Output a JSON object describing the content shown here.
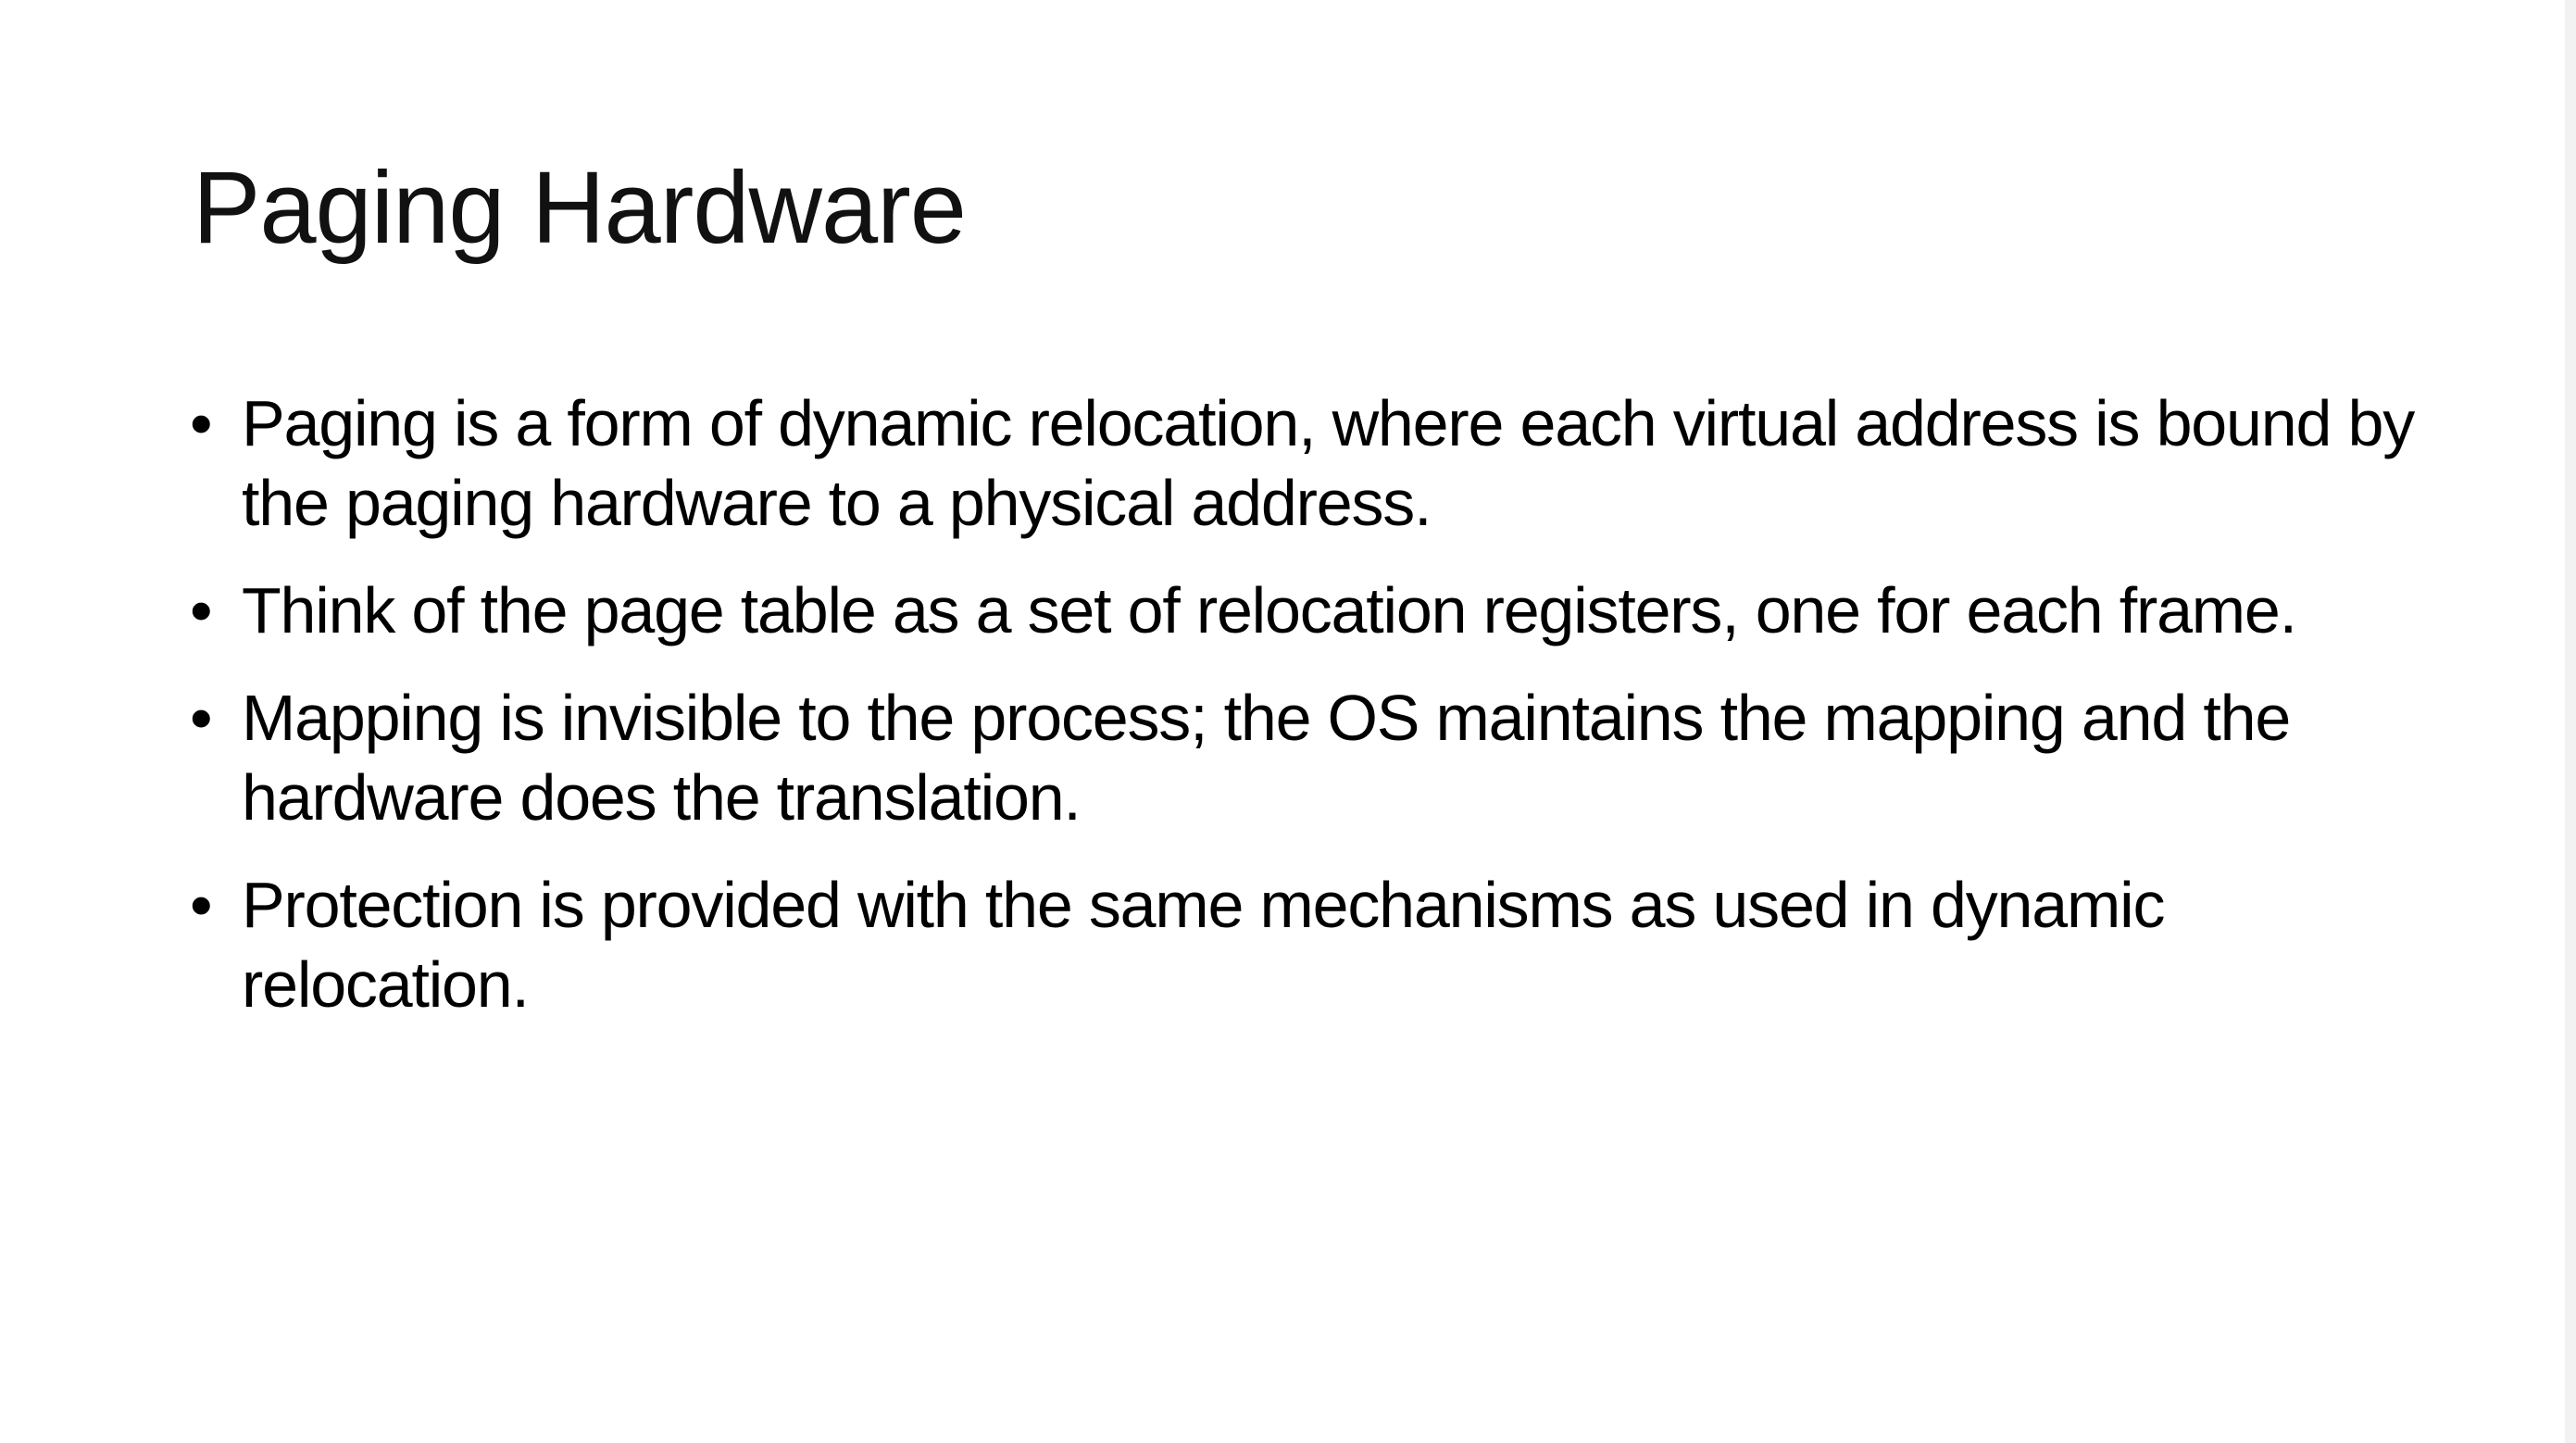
{
  "slide": {
    "title": "Paging Hardware",
    "bullet_marker": "•",
    "bullets": [
      "Paging is a form of dynamic relocation, where each virtual address is bound by the paging hardware to a physical address.",
      "Think of the page table as a set of relocation registers, one for each frame.",
      "Mapping is invisible to the process; the OS maintains the mapping and the hardware does the translation.",
      "Protection is provided with the same mechanisms as used in dynamic relocation."
    ]
  }
}
